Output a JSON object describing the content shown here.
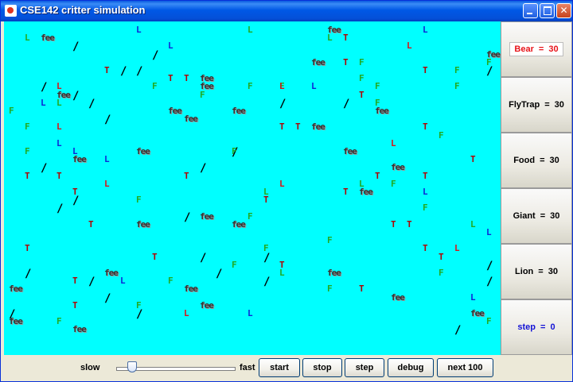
{
  "window": {
    "title": "CSE142 critter simulation"
  },
  "counts": [
    {
      "key": "bear",
      "name": "Bear",
      "value": "30"
    },
    {
      "key": "flytrap",
      "name": "FlyTrap",
      "value": "30"
    },
    {
      "key": "food",
      "name": "Food",
      "value": "30"
    },
    {
      "key": "giant",
      "name": "Giant",
      "value": "30"
    },
    {
      "key": "lion",
      "name": "Lion",
      "value": "30"
    },
    {
      "key": "step",
      "name": "step",
      "value": "0"
    }
  ],
  "controls": {
    "slow_label": "slow",
    "fast_label": "fast",
    "speed_fraction": 0.1,
    "buttons": [
      "start",
      "stop",
      "step",
      "debug",
      "next 100"
    ]
  },
  "colors": {
    "arena": "#00ffff",
    "lion_red": "#d8161b",
    "lion_blue": "#0e26d6",
    "lion_green": "#22aa22",
    "flytrap": "#b00000",
    "food": "#22aa22",
    "giant": "#333333",
    "bear": "#000000",
    "bear_count_text": "#e8141a",
    "step_text": "#1414d6"
  },
  "grid": {
    "critters": [
      {
        "c": 1,
        "r": 1,
        "t": "L",
        "k": "LG"
      },
      {
        "c": 2,
        "r": 1,
        "t": "fee",
        "k": "fee"
      },
      {
        "c": 8,
        "r": 0,
        "t": "L",
        "k": "LB"
      },
      {
        "c": 15,
        "r": 0,
        "t": "L",
        "k": "LG"
      },
      {
        "c": 20,
        "r": 0,
        "t": "fee",
        "k": "fee"
      },
      {
        "c": 26,
        "r": 0,
        "t": "L",
        "k": "LB"
      },
      {
        "c": 4,
        "r": 2,
        "t": "/",
        "k": "slash"
      },
      {
        "c": 10,
        "r": 2,
        "t": "L",
        "k": "LB"
      },
      {
        "c": 20,
        "r": 1,
        "t": "L",
        "k": "LG"
      },
      {
        "c": 21,
        "r": 1,
        "t": "T",
        "k": "T"
      },
      {
        "c": 25,
        "r": 2,
        "t": "L",
        "k": "L"
      },
      {
        "c": 30,
        "r": 3,
        "t": "fee",
        "k": "fee"
      },
      {
        "c": 9,
        "r": 3,
        "t": "/",
        "k": "slash"
      },
      {
        "c": 19,
        "r": 4,
        "t": "fee",
        "k": "fee"
      },
      {
        "c": 21,
        "r": 4,
        "t": "T",
        "k": "T"
      },
      {
        "c": 22,
        "r": 4,
        "t": "F",
        "k": "F"
      },
      {
        "c": 30,
        "r": 4,
        "t": "F",
        "k": "F"
      },
      {
        "c": 6,
        "r": 5,
        "t": "T",
        "k": "T"
      },
      {
        "c": 7,
        "r": 5,
        "t": "/",
        "k": "slash"
      },
      {
        "c": 8,
        "r": 5,
        "t": "/",
        "k": "slash"
      },
      {
        "c": 26,
        "r": 5,
        "t": "T",
        "k": "T"
      },
      {
        "c": 28,
        "r": 5,
        "t": "F",
        "k": "F"
      },
      {
        "c": 30,
        "r": 5,
        "t": "/",
        "k": "slash"
      },
      {
        "c": 22,
        "r": 6,
        "t": "F",
        "k": "F"
      },
      {
        "c": 10,
        "r": 6,
        "t": "T",
        "k": "T"
      },
      {
        "c": 11,
        "r": 6,
        "t": "T",
        "k": "T"
      },
      {
        "c": 12,
        "r": 6,
        "t": "fee",
        "k": "fee"
      },
      {
        "c": 3,
        "r": 7,
        "t": "L",
        "k": "L"
      },
      {
        "c": 9,
        "r": 7,
        "t": "F",
        "k": "F"
      },
      {
        "c": 12,
        "r": 7,
        "t": "fee",
        "k": "fee"
      },
      {
        "c": 15,
        "r": 7,
        "t": "F",
        "k": "F"
      },
      {
        "c": 17,
        "r": 7,
        "t": "F",
        "k": "F"
      },
      {
        "c": 17,
        "r": 7,
        "t": "L",
        "k": "L"
      },
      {
        "c": 19,
        "r": 7,
        "t": "L",
        "k": "LB"
      },
      {
        "c": 23,
        "r": 7,
        "t": "F",
        "k": "F"
      },
      {
        "c": 28,
        "r": 7,
        "t": "F",
        "k": "F"
      },
      {
        "c": 2,
        "r": 7,
        "t": "/",
        "k": "slash"
      },
      {
        "c": 3,
        "r": 8,
        "t": "fee",
        "k": "fee"
      },
      {
        "c": 4,
        "r": 8,
        "t": "/",
        "k": "slash"
      },
      {
        "c": 12,
        "r": 8,
        "t": "F",
        "k": "F"
      },
      {
        "c": 22,
        "r": 8,
        "t": "T",
        "k": "T"
      },
      {
        "c": 2,
        "r": 9,
        "t": "L",
        "k": "LB"
      },
      {
        "c": 3,
        "r": 9,
        "t": "L",
        "k": "LG"
      },
      {
        "c": 5,
        "r": 9,
        "t": "/",
        "k": "slash"
      },
      {
        "c": 17,
        "r": 9,
        "t": "/",
        "k": "slash"
      },
      {
        "c": 21,
        "r": 9,
        "t": "/",
        "k": "slash"
      },
      {
        "c": 23,
        "r": 9,
        "t": "F",
        "k": "F"
      },
      {
        "c": 0,
        "r": 10,
        "t": "F",
        "k": "F"
      },
      {
        "c": 10,
        "r": 10,
        "t": "fee",
        "k": "fee"
      },
      {
        "c": 14,
        "r": 10,
        "t": "fee",
        "k": "fee"
      },
      {
        "c": 23,
        "r": 10,
        "t": "fee",
        "k": "fee"
      },
      {
        "c": 6,
        "r": 11,
        "t": "/",
        "k": "slash"
      },
      {
        "c": 11,
        "r": 11,
        "t": "fee",
        "k": "fee"
      },
      {
        "c": 1,
        "r": 12,
        "t": "F",
        "k": "F"
      },
      {
        "c": 3,
        "r": 12,
        "t": "L",
        "k": "L"
      },
      {
        "c": 17,
        "r": 12,
        "t": "T",
        "k": "T"
      },
      {
        "c": 18,
        "r": 12,
        "t": "T",
        "k": "T"
      },
      {
        "c": 19,
        "r": 12,
        "t": "fee",
        "k": "fee"
      },
      {
        "c": 26,
        "r": 12,
        "t": "T",
        "k": "T"
      },
      {
        "c": 27,
        "r": 13,
        "t": "F",
        "k": "F"
      },
      {
        "c": 3,
        "r": 14,
        "t": "L",
        "k": "LB"
      },
      {
        "c": 24,
        "r": 14,
        "t": "L",
        "k": "L"
      },
      {
        "c": 1,
        "r": 15,
        "t": "F",
        "k": "F"
      },
      {
        "c": 4,
        "r": 15,
        "t": "L",
        "k": "LB"
      },
      {
        "c": 8,
        "r": 15,
        "t": "fee",
        "k": "fee"
      },
      {
        "c": 14,
        "r": 15,
        "t": "/",
        "k": "slash"
      },
      {
        "c": 14,
        "r": 15,
        "t": "F",
        "k": "F"
      },
      {
        "c": 21,
        "r": 15,
        "t": "fee",
        "k": "fee"
      },
      {
        "c": 4,
        "r": 16,
        "t": "fee",
        "k": "fee"
      },
      {
        "c": 6,
        "r": 16,
        "t": "L",
        "k": "LB"
      },
      {
        "c": 29,
        "r": 16,
        "t": "T",
        "k": "T"
      },
      {
        "c": 2,
        "r": 17,
        "t": "/",
        "k": "slash"
      },
      {
        "c": 12,
        "r": 17,
        "t": "/",
        "k": "slash"
      },
      {
        "c": 24,
        "r": 17,
        "t": "fee",
        "k": "fee"
      },
      {
        "c": 1,
        "r": 18,
        "t": "T",
        "k": "T"
      },
      {
        "c": 3,
        "r": 18,
        "t": "T",
        "k": "T"
      },
      {
        "c": 11,
        "r": 18,
        "t": "T",
        "k": "T"
      },
      {
        "c": 23,
        "r": 18,
        "t": "T",
        "k": "T"
      },
      {
        "c": 26,
        "r": 18,
        "t": "T",
        "k": "T"
      },
      {
        "c": 6,
        "r": 19,
        "t": "L",
        "k": "L"
      },
      {
        "c": 17,
        "r": 19,
        "t": "L",
        "k": "L"
      },
      {
        "c": 22,
        "r": 19,
        "t": "L",
        "k": "LG"
      },
      {
        "c": 24,
        "r": 19,
        "t": "F",
        "k": "F"
      },
      {
        "c": 4,
        "r": 20,
        "t": "T",
        "k": "T"
      },
      {
        "c": 16,
        "r": 20,
        "t": "L",
        "k": "LG"
      },
      {
        "c": 21,
        "r": 20,
        "t": "T",
        "k": "T"
      },
      {
        "c": 22,
        "r": 20,
        "t": "fee",
        "k": "fee"
      },
      {
        "c": 26,
        "r": 20,
        "t": "L",
        "k": "LB"
      },
      {
        "c": 4,
        "r": 21,
        "t": "/",
        "k": "slash"
      },
      {
        "c": 8,
        "r": 21,
        "t": "F",
        "k": "F"
      },
      {
        "c": 16,
        "r": 21,
        "t": "T",
        "k": "T"
      },
      {
        "c": 3,
        "r": 22,
        "t": "/",
        "k": "slash"
      },
      {
        "c": 26,
        "r": 22,
        "t": "F",
        "k": "F"
      },
      {
        "c": 11,
        "r": 23,
        "t": "/",
        "k": "slash"
      },
      {
        "c": 12,
        "r": 23,
        "t": "fee",
        "k": "fee"
      },
      {
        "c": 15,
        "r": 23,
        "t": "F",
        "k": "F"
      },
      {
        "c": 5,
        "r": 24,
        "t": "T",
        "k": "T"
      },
      {
        "c": 8,
        "r": 24,
        "t": "fee",
        "k": "fee"
      },
      {
        "c": 14,
        "r": 24,
        "t": "fee",
        "k": "fee"
      },
      {
        "c": 24,
        "r": 24,
        "t": "T",
        "k": "T"
      },
      {
        "c": 25,
        "r": 24,
        "t": "T",
        "k": "T"
      },
      {
        "c": 29,
        "r": 24,
        "t": "L",
        "k": "LG"
      },
      {
        "c": 30,
        "r": 25,
        "t": "L",
        "k": "LB"
      },
      {
        "c": 20,
        "r": 26,
        "t": "F",
        "k": "F"
      },
      {
        "c": 1,
        "r": 27,
        "t": "T",
        "k": "T"
      },
      {
        "c": 16,
        "r": 27,
        "t": "F",
        "k": "F"
      },
      {
        "c": 26,
        "r": 27,
        "t": "T",
        "k": "T"
      },
      {
        "c": 28,
        "r": 27,
        "t": "L",
        "k": "L"
      },
      {
        "c": 9,
        "r": 28,
        "t": "T",
        "k": "T"
      },
      {
        "c": 12,
        "r": 28,
        "t": "/",
        "k": "slash"
      },
      {
        "c": 16,
        "r": 28,
        "t": "/",
        "k": "slash"
      },
      {
        "c": 27,
        "r": 28,
        "t": "T",
        "k": "T"
      },
      {
        "c": 14,
        "r": 29,
        "t": "F",
        "k": "F"
      },
      {
        "c": 17,
        "r": 29,
        "t": "T",
        "k": "T"
      },
      {
        "c": 30,
        "r": 29,
        "t": "/",
        "k": "slash"
      },
      {
        "c": 1,
        "r": 30,
        "t": "/",
        "k": "slash"
      },
      {
        "c": 6,
        "r": 30,
        "t": "fee",
        "k": "fee"
      },
      {
        "c": 13,
        "r": 30,
        "t": "/",
        "k": "slash"
      },
      {
        "c": 17,
        "r": 30,
        "t": "L",
        "k": "LG"
      },
      {
        "c": 20,
        "r": 30,
        "t": "fee",
        "k": "fee"
      },
      {
        "c": 27,
        "r": 30,
        "t": "F",
        "k": "F"
      },
      {
        "c": 4,
        "r": 31,
        "t": "T",
        "k": "T"
      },
      {
        "c": 5,
        "r": 31,
        "t": "/",
        "k": "slash"
      },
      {
        "c": 7,
        "r": 31,
        "t": "L",
        "k": "LB"
      },
      {
        "c": 10,
        "r": 31,
        "t": "F",
        "k": "F"
      },
      {
        "c": 16,
        "r": 31,
        "t": "/",
        "k": "slash"
      },
      {
        "c": 30,
        "r": 31,
        "t": "/",
        "k": "slash"
      },
      {
        "c": 0,
        "r": 32,
        "t": "fee",
        "k": "fee"
      },
      {
        "c": 11,
        "r": 32,
        "t": "fee",
        "k": "fee"
      },
      {
        "c": 20,
        "r": 32,
        "t": "F",
        "k": "F"
      },
      {
        "c": 22,
        "r": 32,
        "t": "T",
        "k": "T"
      },
      {
        "c": 6,
        "r": 33,
        "t": "/",
        "k": "slash"
      },
      {
        "c": 24,
        "r": 33,
        "t": "fee",
        "k": "fee"
      },
      {
        "c": 29,
        "r": 33,
        "t": "L",
        "k": "LB"
      },
      {
        "c": 4,
        "r": 34,
        "t": "T",
        "k": "T"
      },
      {
        "c": 8,
        "r": 34,
        "t": "F",
        "k": "F"
      },
      {
        "c": 12,
        "r": 34,
        "t": "fee",
        "k": "fee"
      },
      {
        "c": 0,
        "r": 35,
        "t": "/",
        "k": "slash"
      },
      {
        "c": 8,
        "r": 35,
        "t": "/",
        "k": "slash"
      },
      {
        "c": 11,
        "r": 35,
        "t": "L",
        "k": "L"
      },
      {
        "c": 15,
        "r": 35,
        "t": "L",
        "k": "LB"
      },
      {
        "c": 29,
        "r": 35,
        "t": "fee",
        "k": "fee"
      },
      {
        "c": 0,
        "r": 36,
        "t": "fee",
        "k": "fee"
      },
      {
        "c": 3,
        "r": 36,
        "t": "F",
        "k": "F"
      },
      {
        "c": 30,
        "r": 36,
        "t": "F",
        "k": "F"
      },
      {
        "c": 4,
        "r": 37,
        "t": "fee",
        "k": "fee"
      },
      {
        "c": 28,
        "r": 37,
        "t": "/",
        "k": "slash"
      }
    ]
  }
}
